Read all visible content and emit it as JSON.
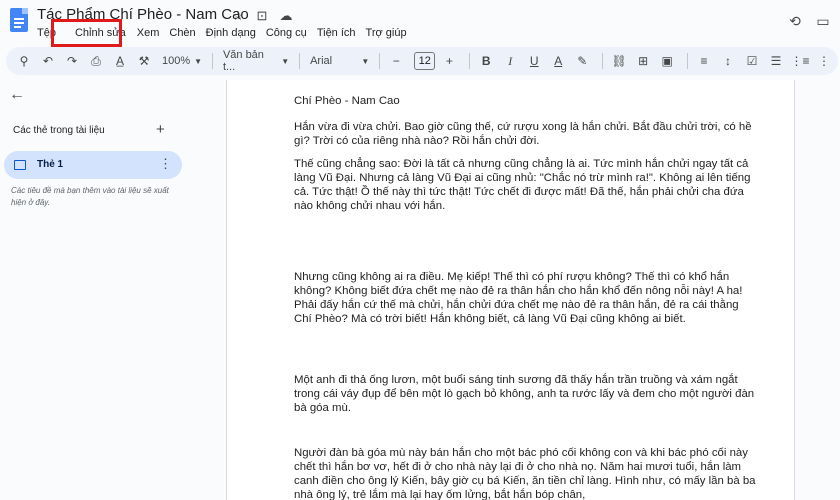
{
  "title": "Tác Phẩm Chí Phèo -  Nam Cao",
  "title_icons": [
    "☆",
    "⊡",
    "☁"
  ],
  "menu": [
    "Tệp",
    "Chỉnh sửa",
    "Xem",
    "Chèn",
    "Định dạng",
    "Công cụ",
    "Tiện ích",
    "Trợ giúp"
  ],
  "right_icons": [
    "⟲",
    "▭"
  ],
  "toolbar": {
    "search": "⚲",
    "undo": "↶",
    "redo": "↷",
    "print": "⎙",
    "spellcheck": "A̲",
    "paint_format": "⚒",
    "zoom": "100%",
    "style": "Văn bản t...",
    "font": "Arial",
    "minus": "−",
    "size": "12",
    "plus": "+",
    "bold": "B",
    "italic": "I",
    "underline": "U",
    "text_color": "A",
    "highlight": "✎",
    "link": "⛓",
    "comment": "⊞",
    "image": "▣",
    "align": "≡",
    "line_spacing": "↕",
    "checklist": "☑",
    "bullets": "☰",
    "numbered": "⋮≡",
    "more": "⋮"
  },
  "sidebar": {
    "back": "←",
    "heading": "Các thẻ trong tài liệu",
    "add": "+",
    "tab_label": "Thẻ 1",
    "tab_menu": "⋮",
    "hint": "Các tiêu đề mà bạn thêm vào tài liệu sẽ xuất hiện ở đây."
  },
  "document": {
    "title_line": "Chí Phèo -  Nam Cao",
    "paragraphs": [
      "Hắn vừa đi vừa chửi. Bao giờ cũng thế, cứ rượu xong là hắn chửi. Bắt đầu chửi trời, có hề gì? Trời có của riêng nhà nào? Rồi hắn chửi đời.",
      "Thế cũng chẳng sao: Đời là tất cả nhưng cũng chẳng là ai. Tức mình hắn chửi ngay tất cả làng Vũ Đại. Nhưng cả làng Vũ Đại ai cũng nhủ: \"Chắc nó trừ mình ra!\". Không ai lên tiếng cả. Tức thật! Ồ thế này thì tức thật! Tức chết đi được mất! Đã thế, hắn phải chửi cha đứa nào không chửi nhau với hắn.",
      "Nhưng cũng không ai ra điều. Mẹ kiếp! Thế thì có phí rượu không? Thế thì có khổ hắn không? Không biết đứa chết mẹ nào đẻ ra thân hắn cho hắn khổ đến nông nỗi này! A ha! Phải đấy hắn cứ thế mà chửi, hắn chửi đứa chết mẹ nào đẻ ra thân hắn, đẻ ra cái thằng Chí Phèo? Mà có trời biết! Hắn không biết, cả làng Vũ Đại cũng không ai biết.",
      "Một anh đi thả ống lươn, một buổi sáng tinh sương đã thấy hắn trần truồng và xám ngắt trong cái váy đụp để bên một lò gạch bỏ không, anh ta rước lấy và đem cho một người đàn bà góa mù.",
      "Người đàn bà góa mù này bán hắn cho một bác phó cối không con và khi bác phó cối này chết thì hắn bơ vơ, hết đi ở cho nhà này lại đi ở cho nhà nọ. Năm hai mươi tuổi, hắn làm canh điền cho ông lý Kiến, bây giờ cụ bá Kiến, ăn tiền chỉ làng. Hình như, có mấy lần bà ba nhà ông lý, trẻ lắm mà lại hay ốm lửng, bắt hắn bóp chân,"
    ]
  }
}
